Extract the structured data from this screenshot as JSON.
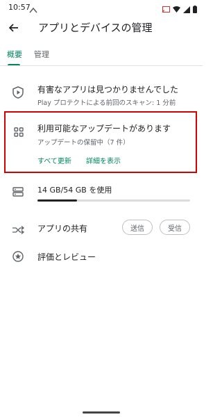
{
  "status_bar": {
    "time": "10:57"
  },
  "header": {
    "title": "アプリとデバイスの管理"
  },
  "tabs": [
    {
      "label": "概要"
    },
    {
      "label": "管理"
    }
  ],
  "protect": {
    "title": "有害なアプリは見つかりませんでした",
    "subtitle": "Play プロテクトによる前回のスキャン: 1 分前"
  },
  "updates": {
    "title": "利用可能なアップデートがあります",
    "subtitle": "アップデートの保留中（7 件）",
    "update_all_label": "すべて更新",
    "details_label": "詳細を表示"
  },
  "storage": {
    "label": "14 GB/54 GB を使用",
    "used_fraction": 0.26
  },
  "share": {
    "label": "アプリの共有",
    "send_label": "送信",
    "receive_label": "受信"
  },
  "ratings": {
    "label": "評価とレビュー"
  },
  "colors": {
    "accent": "#01875f",
    "highlight_border": "#d50000"
  }
}
